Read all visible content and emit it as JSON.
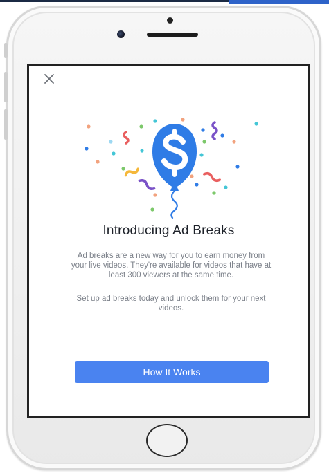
{
  "screen": {
    "close_icon": "close-icon",
    "illustration_icon": "dollar-balloon-confetti-icon",
    "title": "Introducing Ad Breaks",
    "description": "Ad breaks are a new way for you to earn money from your live videos. They're available for videos that have at least 300 viewers at the same time.",
    "secondary_description": "Set up ad breaks today and unlock them for your next videos.",
    "cta_label": "How It Works"
  },
  "colors": {
    "accent_blue": "#4a83f0",
    "balloon_blue": "#2f7ce6",
    "title_text": "#1d2129",
    "body_text": "#7c818a"
  }
}
